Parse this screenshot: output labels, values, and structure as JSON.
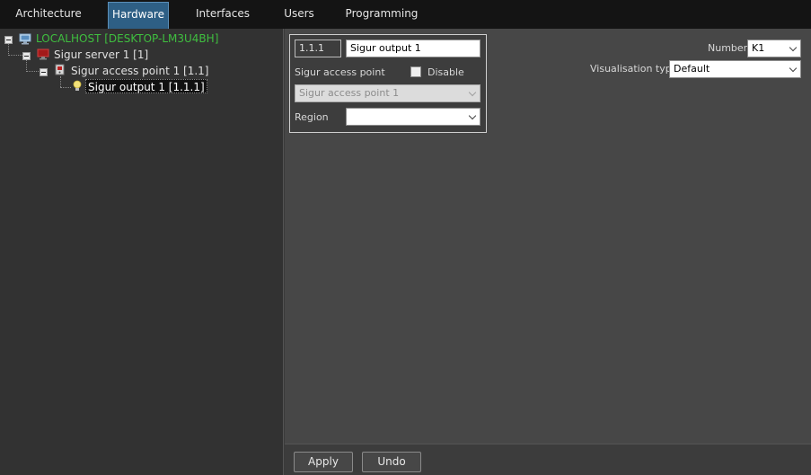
{
  "tabs": [
    {
      "label": "Architecture"
    },
    {
      "label": "Hardware",
      "active": true
    },
    {
      "label": "Interfaces"
    },
    {
      "label": "Users"
    },
    {
      "label": "Programming"
    }
  ],
  "tree": {
    "host": "LOCALHOST [DESKTOP-LM3U4BH]",
    "server": "Sigur server 1 [1]",
    "access_point": "Sigur access point 1 [1.1]",
    "output": "Sigur output 1 [1.1.1]"
  },
  "properties": {
    "id_value": "1.1.1",
    "name_value": "Sigur output 1",
    "access_point_label": "Sigur access point",
    "disable_label": "Disable",
    "disable_checked": false,
    "access_point_value": "Sigur access point 1",
    "region_label": "Region",
    "region_value": ""
  },
  "settings": {
    "number_label": "Number:",
    "number_value": "K1",
    "visualisation_label": "Visualisation type:",
    "visualisation_value": "Default"
  },
  "buttons": {
    "apply": "Apply",
    "undo": "Undo"
  },
  "colors": {
    "active_tab": "#2e5f85",
    "host_text": "#3fbf3f",
    "panel_bg": "#474747"
  }
}
